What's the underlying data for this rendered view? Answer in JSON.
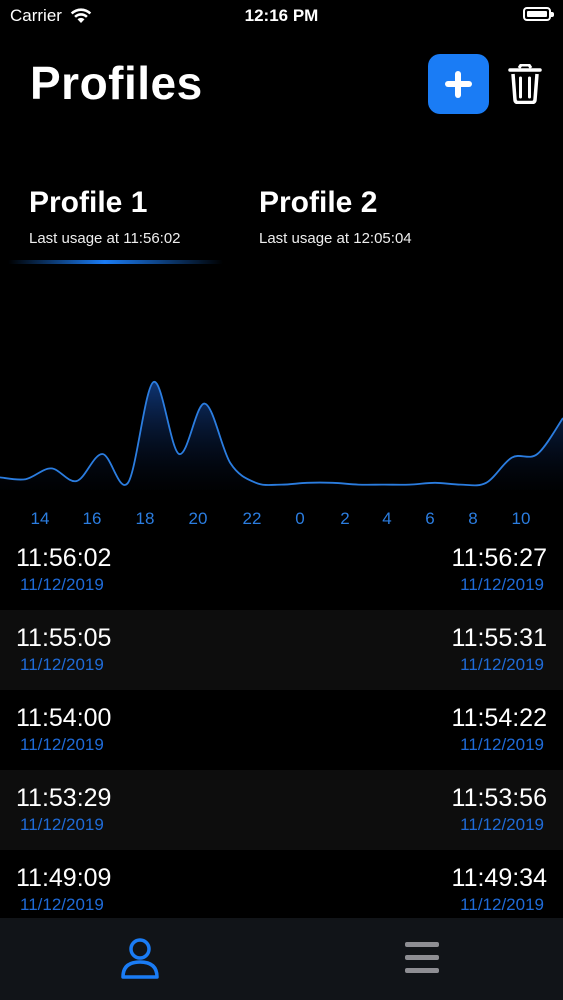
{
  "status_bar": {
    "carrier": "Carrier",
    "time": "12:16 PM"
  },
  "header": {
    "title": "Profiles"
  },
  "profiles": [
    {
      "name": "Profile 1",
      "usage": "Last usage at 11:56:02",
      "selected": true
    },
    {
      "name": "Profile 2",
      "usage": "Last usage at 12:05:04",
      "selected": false
    }
  ],
  "chart_data": {
    "type": "area",
    "x_tick_labels": [
      "14",
      "16",
      "18",
      "20",
      "22",
      "0",
      "2",
      "4",
      "6",
      "8",
      "10"
    ],
    "series": [
      {
        "values": [
          0.07,
          0.06,
          0.12,
          0.05,
          0.2,
          0.04,
          0.6,
          0.2,
          0.48,
          0.15,
          0.04,
          0.03,
          0.04,
          0.04,
          0.03,
          0.03,
          0.03,
          0.04,
          0.03,
          0.04,
          0.18,
          0.2,
          0.4
        ]
      }
    ],
    "ylim": [
      0,
      1
    ],
    "line_color": "#2b7de0"
  },
  "history": [
    {
      "start_time": "11:56:02",
      "start_date": "11/12/2019",
      "end_time": "11:56:27",
      "end_date": "11/12/2019"
    },
    {
      "start_time": "11:55:05",
      "start_date": "11/12/2019",
      "end_time": "11:55:31",
      "end_date": "11/12/2019"
    },
    {
      "start_time": "11:54:00",
      "start_date": "11/12/2019",
      "end_time": "11:54:22",
      "end_date": "11/12/2019"
    },
    {
      "start_time": "11:53:29",
      "start_date": "11/12/2019",
      "end_time": "11:53:56",
      "end_date": "11/12/2019"
    },
    {
      "start_time": "11:49:09",
      "start_date": "11/12/2019",
      "end_time": "11:49:34",
      "end_date": "11/12/2019"
    }
  ],
  "tab_bar": {
    "active": "profile-icon",
    "items": [
      "profile-icon",
      "menu-icon"
    ]
  },
  "colors": {
    "accent": "#1a7cf5",
    "date_text": "#1f6bd8",
    "inactive_icon": "#8e8e93"
  }
}
